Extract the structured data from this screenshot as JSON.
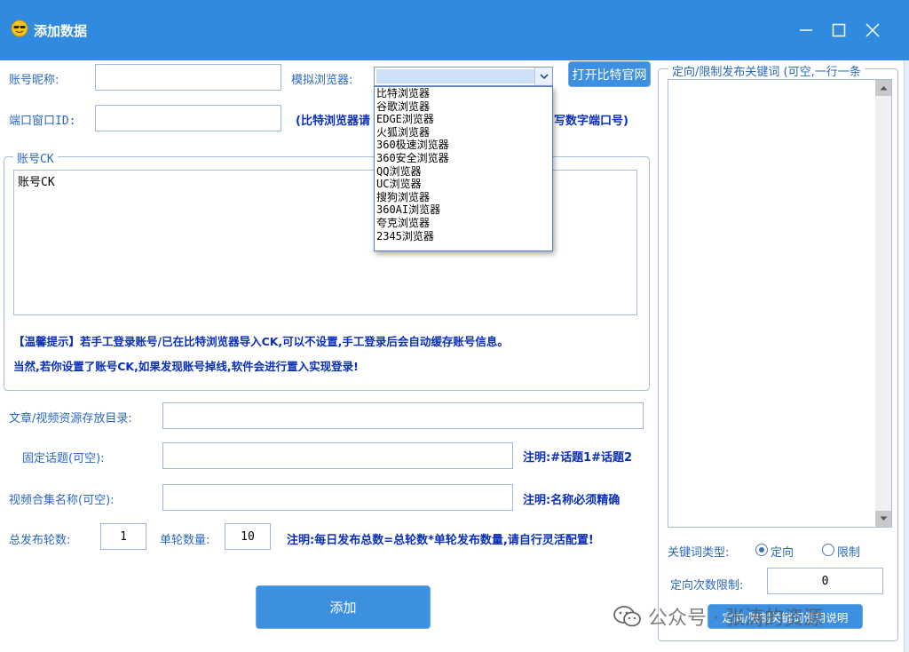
{
  "window": {
    "title": "添加数据"
  },
  "account": {
    "nickname_label": "账号昵称:",
    "nickname_value": "",
    "browser_label": "模拟浏览器:",
    "open_site_button": "打开比特官网",
    "port_label": "端口窗口ID:",
    "port_value": "",
    "port_hint_left": "(比特浏览器请",
    "port_hint_right": "写数字端口号)"
  },
  "browser_options": [
    "比特浏览器",
    "谷歌浏览器",
    "EDGE浏览器",
    "火狐浏览器",
    "360极速浏览器",
    "360安全浏览器",
    "QQ浏览器",
    "UC浏览器",
    "搜狗浏览器",
    "360AI浏览器",
    "夸克浏览器",
    "2345浏览器"
  ],
  "ck_group": {
    "title": "账号CK",
    "textarea_value": "账号CK",
    "tip_line1": "【温馨提示】若手工登录账号/已在比特浏览器导入CK,可以不设置,手工登录后会自动缓存账号信息。",
    "tip_line2": "当然,若你设置了账号CK,如果发现账号掉线,软件会进行置入实现登录!"
  },
  "resources": {
    "dir_label": "文章/视频资源存放目录:",
    "dir_value": "",
    "topic_label": "固定话题(可空):",
    "topic_value": "",
    "topic_note": "注明:#话题1#话题2",
    "collection_label": "视频合集名称(可空):",
    "collection_value": "",
    "collection_note": "注明:名称必须精确"
  },
  "publish": {
    "rounds_label": "总发布轮数:",
    "rounds_value": "1",
    "per_round_label": "单轮数量:",
    "per_round_value": "10",
    "note": "注明:每日发布总数=总轮数*单轮发布数量,请自行灵活配置!"
  },
  "add_button": "添加",
  "keywords": {
    "group_title": "定向/限制发布关键词 (可空,一行一条",
    "textarea_value": "",
    "type_label": "关键词类型:",
    "option_directed": "定向",
    "option_limit": "限制",
    "count_label": "定向次数限制:",
    "count_value": "0",
    "help_button": "定向/限制关键词使用说明"
  },
  "watermark": "公众号 · 张涛的资源"
}
